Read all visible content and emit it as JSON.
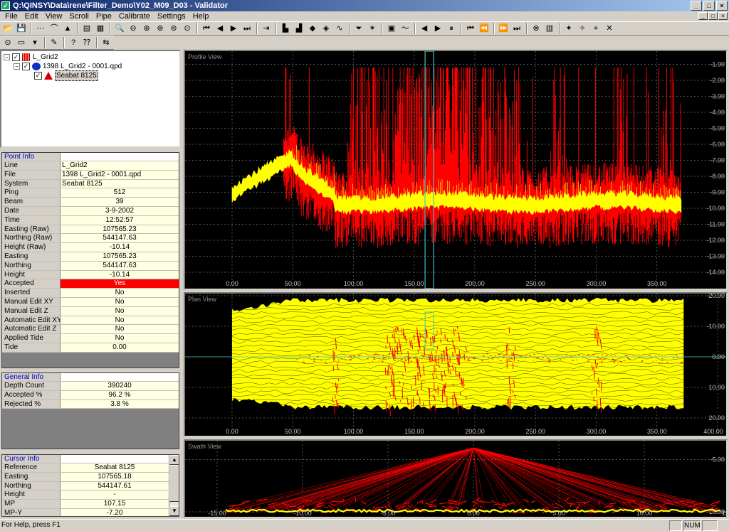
{
  "window": {
    "title": "Q:\\QINSY\\Data\\rene\\Filter_Demo\\Y02_M09_D03 - Validator",
    "buttons": [
      "_",
      "□",
      "×"
    ]
  },
  "menu": [
    "File",
    "Edit",
    "View",
    "Scroll",
    "Pipe",
    "Calibrate",
    "Settings",
    "Help"
  ],
  "mdi_buttons": [
    "_",
    "□",
    "×"
  ],
  "toolbar1": [
    {
      "name": "open-icon",
      "glyph": "📂"
    },
    {
      "name": "save-icon",
      "glyph": "💾"
    },
    {
      "sep": true
    },
    {
      "name": "line-tool-icon",
      "glyph": "⋯"
    },
    {
      "name": "curve-tool-icon",
      "glyph": "⌒"
    },
    {
      "name": "triangle-tool-icon",
      "glyph": "▲"
    },
    {
      "sep": true
    },
    {
      "name": "color-scale-icon",
      "glyph": "▤"
    },
    {
      "name": "grid-icon",
      "glyph": "▦"
    },
    {
      "sep": true
    },
    {
      "name": "zoom-icon",
      "glyph": "🔍"
    },
    {
      "name": "zoom-out-icon",
      "glyph": "⊖"
    },
    {
      "name": "zoom-in-icon",
      "glyph": "⊕"
    },
    {
      "name": "zoom-x-icon",
      "glyph": "⊛"
    },
    {
      "name": "zoom-y-icon",
      "glyph": "⊚"
    },
    {
      "name": "zoom-reset-icon",
      "glyph": "⊙"
    },
    {
      "sep": true
    },
    {
      "name": "first-ping-icon",
      "glyph": "⏮"
    },
    {
      "name": "prev-ping-icon",
      "glyph": "◀"
    },
    {
      "name": "next-ping-icon",
      "glyph": "▶"
    },
    {
      "name": "last-ping-icon",
      "glyph": "⏭"
    },
    {
      "sep": true
    },
    {
      "name": "end-icon",
      "glyph": "⇥"
    },
    {
      "sep": true
    },
    {
      "name": "plot-red-icon",
      "glyph": "▙"
    },
    {
      "name": "plot-blue-icon",
      "glyph": "▟"
    },
    {
      "name": "shape-icon",
      "glyph": "◆"
    },
    {
      "name": "shape2-icon",
      "glyph": "◈"
    },
    {
      "name": "wave-icon",
      "glyph": "∿"
    },
    {
      "sep": true
    },
    {
      "name": "funnel-icon",
      "glyph": "⏷"
    },
    {
      "name": "star-icon",
      "glyph": "✶"
    },
    {
      "sep": true
    },
    {
      "name": "view-icon",
      "glyph": "▣"
    },
    {
      "name": "track-icon",
      "glyph": "〜"
    },
    {
      "sep": true
    },
    {
      "name": "play-back-icon",
      "glyph": "◀"
    },
    {
      "name": "play-icon",
      "glyph": "▶"
    },
    {
      "name": "pause-icon",
      "glyph": "⏸"
    },
    {
      "sep": true
    },
    {
      "name": "rewind-start-icon",
      "glyph": "⏮"
    },
    {
      "name": "rewind-icon",
      "glyph": "⏪"
    },
    {
      "sep": true
    },
    {
      "name": "forward-icon",
      "glyph": "⏩"
    },
    {
      "name": "forward-end-icon",
      "glyph": "⏭"
    },
    {
      "sep": true
    },
    {
      "name": "pipe-icon",
      "glyph": "⊗"
    },
    {
      "name": "cube-icon",
      "glyph": "▥"
    },
    {
      "sep": true
    },
    {
      "name": "tool-a-icon",
      "glyph": "✦"
    },
    {
      "name": "tool-b-icon",
      "glyph": "✧"
    },
    {
      "name": "tool-c-icon",
      "glyph": "⌖"
    },
    {
      "name": "tool-d-icon",
      "glyph": "✕"
    }
  ],
  "toolbar2": [
    {
      "name": "record-icon",
      "glyph": "⊙"
    },
    {
      "name": "box-icon",
      "glyph": "▭"
    },
    {
      "name": "dropdown-icon",
      "glyph": "▾"
    },
    {
      "sep": true
    },
    {
      "name": "brush-icon",
      "glyph": "✎"
    },
    {
      "sep": true
    },
    {
      "name": "help-icon",
      "glyph": "?"
    },
    {
      "name": "whats-this-icon",
      "glyph": "⁇"
    },
    {
      "sep": true
    },
    {
      "name": "nav-icon",
      "glyph": "⇆"
    }
  ],
  "tree": {
    "root": "L_Grid2",
    "child": "1398 L_Grid2 - 0001.qpd",
    "leaf": "Seabat 8125"
  },
  "point_info": {
    "header": "Point Info",
    "rows": [
      {
        "k": "Line",
        "v": "L_Grid2",
        "align": "left"
      },
      {
        "k": "File",
        "v": "1398 L_Grid2 - 0001.qpd",
        "align": "left"
      },
      {
        "k": "System",
        "v": "Seabat 8125",
        "align": "left"
      },
      {
        "k": "Ping",
        "v": "512"
      },
      {
        "k": "Beam",
        "v": "39"
      },
      {
        "k": "Date",
        "v": "3-9-2002"
      },
      {
        "k": "Time",
        "v": "12:52:57"
      },
      {
        "k": "Easting (Raw)",
        "v": "107565.23"
      },
      {
        "k": "Northing (Raw)",
        "v": "544147.63"
      },
      {
        "k": "Height (Raw)",
        "v": "-10.14"
      },
      {
        "k": "Easting",
        "v": "107565.23"
      },
      {
        "k": "Northing",
        "v": "544147.63"
      },
      {
        "k": "Height",
        "v": "-10.14"
      },
      {
        "k": "Accepted",
        "v": "Yes",
        "highlight": true
      },
      {
        "k": "Inserted",
        "v": "No"
      },
      {
        "k": "Manual Edit XY",
        "v": "No"
      },
      {
        "k": "Manual Edit Z",
        "v": "No"
      },
      {
        "k": "Automatic Edit XY",
        "v": "No"
      },
      {
        "k": "Automatic Edit Z",
        "v": "No"
      },
      {
        "k": "Applied Tide",
        "v": "No"
      },
      {
        "k": "Tide",
        "v": "0.00"
      }
    ]
  },
  "general_info": {
    "header": "General Info",
    "rows": [
      {
        "k": "Depth Count",
        "v": "390240"
      },
      {
        "k": "Accepted %",
        "v": "96.2 %"
      },
      {
        "k": "Rejected %",
        "v": "3.8 %"
      }
    ]
  },
  "cursor_info": {
    "header": "Cursor Info",
    "rows": [
      {
        "k": "Reference",
        "v": "Seabat 8125"
      },
      {
        "k": "Easting",
        "v": "107565.18"
      },
      {
        "k": "Northing",
        "v": "544147.61"
      },
      {
        "k": "Height",
        "v": "-"
      },
      {
        "k": "MP",
        "v": "107.15"
      },
      {
        "k": "MP-Y",
        "v": "-7.20"
      }
    ]
  },
  "status": {
    "help": "For Help, press F1",
    "num": "NUM"
  },
  "views": {
    "profile": {
      "title": "Profile View",
      "x_ticks": [
        "0.00",
        "50.00",
        "100.00",
        "150.00",
        "200.00",
        "250.00",
        "300.00",
        "350.00"
      ],
      "y_ticks": [
        "-1.00",
        "-2.00",
        "-3.00",
        "-4.00",
        "-5.00",
        "-6.00",
        "-7.00",
        "-8.00",
        "-9.00",
        "-10.00",
        "-11.00",
        "-12.00",
        "-13.00",
        "-14.00"
      ]
    },
    "plan": {
      "title": "Plan View",
      "x_ticks": [
        "0.00",
        "50.00",
        "100.00",
        "150.00",
        "200.00",
        "250.00",
        "300.00",
        "350.00",
        "400.00"
      ],
      "y_ticks": [
        "-20.00",
        "-10.00",
        "0.00",
        "10.00",
        "20.00"
      ]
    },
    "swath": {
      "title": "Swath View",
      "x_ticks": [
        "-15.00",
        "-10.00",
        "-5.00",
        "0.00",
        "5.00",
        "10.00",
        "15.00"
      ],
      "y_ticks": [
        "-5.00",
        "-10.00"
      ]
    }
  },
  "colors": {
    "accepted": "#ffff00",
    "rejected": "#ff0000",
    "cursor": "#40c0c0",
    "grid": "#707070",
    "highlight": "#ff0000"
  }
}
